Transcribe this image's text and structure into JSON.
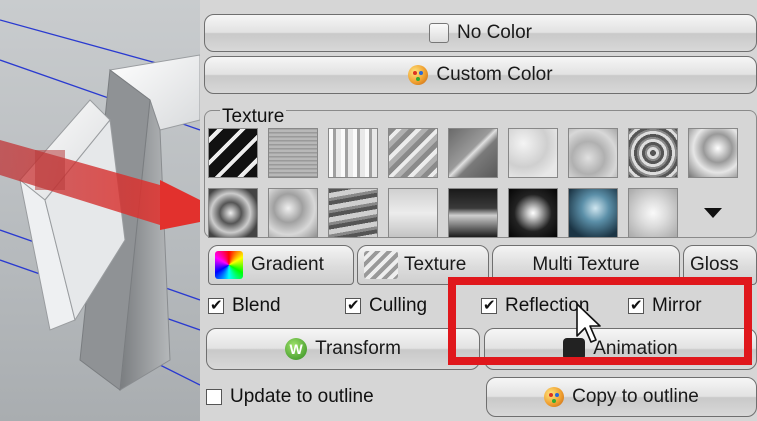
{
  "buttons": {
    "no_color": "No Color",
    "custom_color": "Custom Color",
    "transform": "Transform",
    "animation": "Animation",
    "copy_to_outline": "Copy to outline"
  },
  "texture": {
    "label": "Texture",
    "tiles_row1": [
      "tex-black-stripes",
      "tex-brushed",
      "tex-metal-bars",
      "tex-diagonal-glass",
      "tex-dark-glass",
      "tex-light-marble",
      "tex-water-ripple",
      "tex-crumpled",
      "tex-swirl"
    ],
    "tiles_row2": [
      "tex-dark-swirl",
      "tex-liquid",
      "tex-waves",
      "tex-soft-gradient",
      "tex-dark-horizon",
      "tex-spotlight",
      "tex-blue-glow",
      "tex-radial-soft"
    ]
  },
  "tabs": [
    {
      "label": "Gradient",
      "icon": "gradient-icon"
    },
    {
      "label": "Texture",
      "icon": "texture-icon"
    },
    {
      "label": "Multi Texture",
      "icon": ""
    },
    {
      "label": "Gloss",
      "icon": ""
    }
  ],
  "options": {
    "blend": {
      "label": "Blend",
      "checked": true
    },
    "culling": {
      "label": "Culling",
      "checked": true
    },
    "reflection": {
      "label": "Reflection",
      "checked": true
    },
    "mirror": {
      "label": "Mirror",
      "checked": true
    }
  },
  "update_to_outline": {
    "label": "Update to outline",
    "checked": false
  },
  "colors": {
    "highlight": "#e0171c",
    "panel": "#d6d6d6"
  }
}
